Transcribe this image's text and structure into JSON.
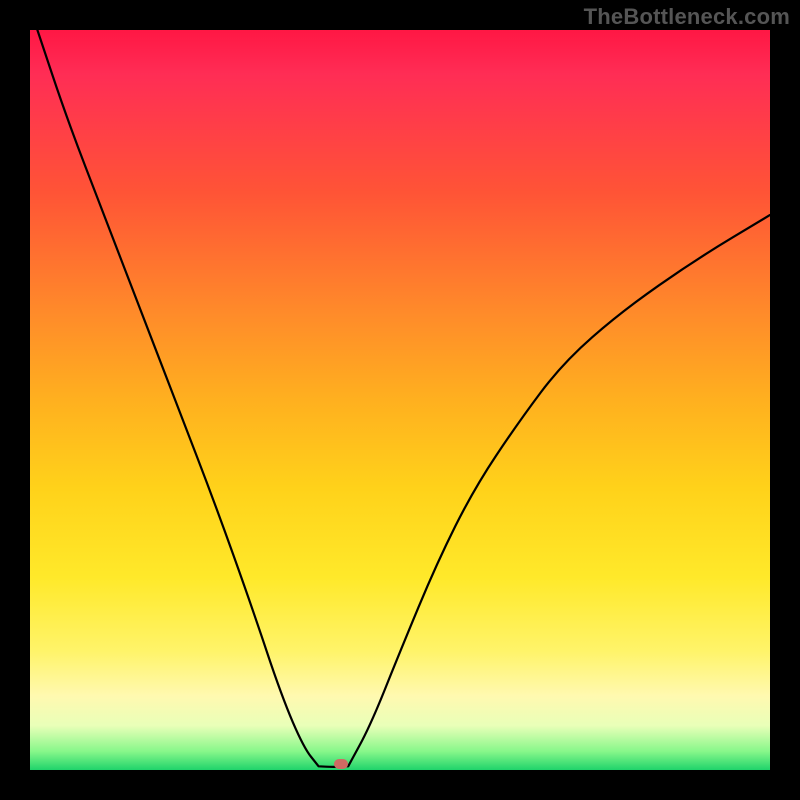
{
  "watermark": "TheBottleneck.com",
  "chart_data": {
    "type": "line",
    "title": "",
    "xlabel": "",
    "ylabel": "",
    "xlim": [
      0,
      1
    ],
    "ylim": [
      0,
      1
    ],
    "notes": "V-shaped bottleneck curve on heat gradient; minimum near x≈0.40; left branch starts at top-left, right branch rises to y≈0.75 at x=1.",
    "series": [
      {
        "name": "left",
        "x": [
          0.01,
          0.05,
          0.1,
          0.15,
          0.2,
          0.25,
          0.3,
          0.34,
          0.37,
          0.39
        ],
        "y": [
          1.0,
          0.88,
          0.75,
          0.62,
          0.49,
          0.36,
          0.22,
          0.1,
          0.03,
          0.005
        ]
      },
      {
        "name": "floor",
        "x": [
          0.39,
          0.41,
          0.43
        ],
        "y": [
          0.005,
          0.004,
          0.005
        ]
      },
      {
        "name": "right",
        "x": [
          0.43,
          0.46,
          0.5,
          0.55,
          0.6,
          0.66,
          0.72,
          0.8,
          0.9,
          1.0
        ],
        "y": [
          0.005,
          0.06,
          0.16,
          0.28,
          0.38,
          0.47,
          0.55,
          0.62,
          0.69,
          0.75
        ]
      }
    ],
    "marker": {
      "x": 0.42,
      "y": 0.008,
      "color": "#ce6b63"
    }
  },
  "colors": {
    "curve": "#000000",
    "marker": "#ce6b63",
    "frame": "#000000"
  }
}
